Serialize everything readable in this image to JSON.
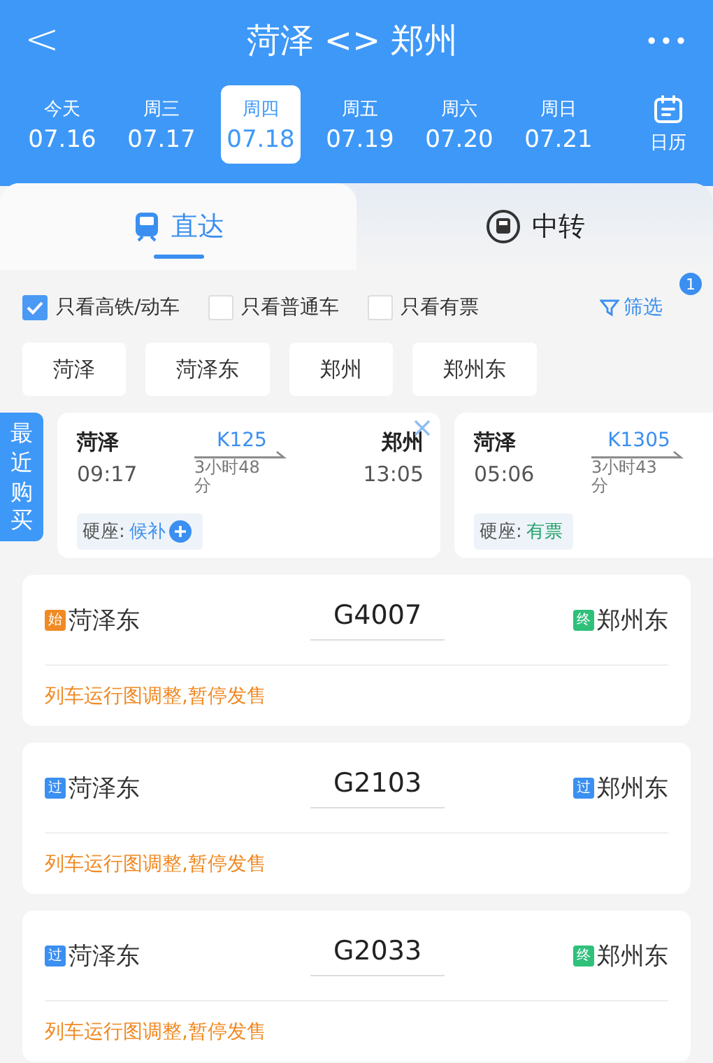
{
  "header": {
    "back": "<",
    "title": "菏泽 <> 郑州",
    "more": "•••"
  },
  "dates": [
    {
      "weekday": "今天",
      "date": "07.16",
      "selected": false
    },
    {
      "weekday": "周三",
      "date": "07.17",
      "selected": false
    },
    {
      "weekday": "周四",
      "date": "07.18",
      "selected": true
    },
    {
      "weekday": "周五",
      "date": "07.19",
      "selected": false
    },
    {
      "weekday": "周六",
      "date": "07.20",
      "selected": false
    },
    {
      "weekday": "周日",
      "date": "07.21",
      "selected": false
    }
  ],
  "calendar": {
    "label": "日历"
  },
  "tabs": [
    {
      "label": "直达",
      "selected": true
    },
    {
      "label": "中转",
      "selected": false
    }
  ],
  "filters": [
    {
      "label": "只看高铁/动车",
      "checked": true
    },
    {
      "label": "只看普通车",
      "checked": false
    },
    {
      "label": "只看有票",
      "checked": false
    }
  ],
  "filter_button": {
    "label": "筛选",
    "badge": "1"
  },
  "stations": [
    "菏泽",
    "菏泽东",
    "郑州",
    "郑州东"
  ],
  "recent": {
    "label": "最近购买",
    "cards": [
      {
        "from": "菏泽",
        "depart": "09:17",
        "train": "K125",
        "duration": "3小时48分",
        "to": "郑州",
        "arrive": "13:05",
        "seat": "硬座:",
        "status": "候补",
        "kind": "waitlist",
        "closable": true
      },
      {
        "from": "菏泽",
        "depart": "05:06",
        "train": "K1305",
        "duration": "3小时43分",
        "seat": "硬座:",
        "status": "有票",
        "kind": "available",
        "closable": false
      }
    ]
  },
  "trains": [
    {
      "from_badge": {
        "text": "始",
        "color": "#f08a24"
      },
      "from": "菏泽东",
      "train": "G4007",
      "to_badge": {
        "text": "终",
        "color": "#2fc07a"
      },
      "to": "郑州东",
      "notice": "列车运行图调整,暂停发售"
    },
    {
      "from_badge": {
        "text": "过",
        "color": "#3b8ff0"
      },
      "from": "菏泽东",
      "train": "G2103",
      "to_badge": {
        "text": "过",
        "color": "#3b8ff0"
      },
      "to": "郑州东",
      "notice": "列车运行图调整,暂停发售"
    },
    {
      "from_badge": {
        "text": "过",
        "color": "#3b8ff0"
      },
      "from": "菏泽东",
      "train": "G2033",
      "to_badge": {
        "text": "终",
        "color": "#2fc07a"
      },
      "to": "郑州东",
      "notice": "列车运行图调整,暂停发售"
    }
  ]
}
